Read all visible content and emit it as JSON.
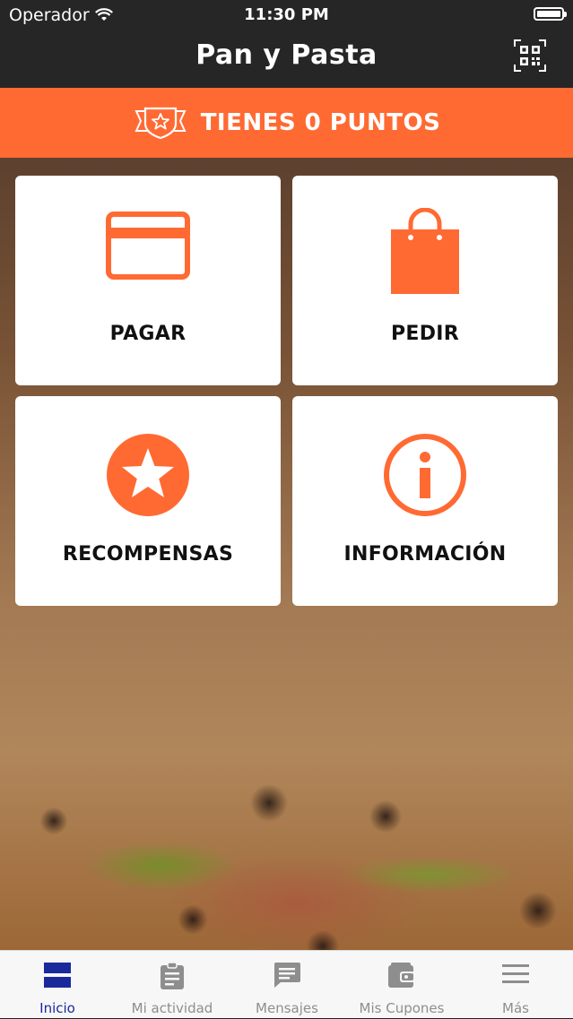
{
  "status": {
    "carrier": "Operador",
    "time": "11:30 PM"
  },
  "header": {
    "title": "Pan y Pasta",
    "qr_icon": "qr-code-icon"
  },
  "points": {
    "text": "TIENES 0 PUNTOS",
    "icon": "badge-star-icon"
  },
  "tiles": [
    {
      "label": "PAGAR",
      "icon": "credit-card-icon"
    },
    {
      "label": "PEDIR",
      "icon": "shopping-bag-icon"
    },
    {
      "label": "RECOMPENSAS",
      "icon": "star-circle-icon"
    },
    {
      "label": "INFORMACIÓN",
      "icon": "info-circle-icon"
    }
  ],
  "tabs": [
    {
      "label": "Inicio",
      "icon": "home-grid-icon",
      "active": true
    },
    {
      "label": "Mi actividad",
      "icon": "clipboard-icon",
      "active": false
    },
    {
      "label": "Mensajes",
      "icon": "message-icon",
      "active": false
    },
    {
      "label": "Mis Cupones",
      "icon": "wallet-icon",
      "active": false
    },
    {
      "label": "Más",
      "icon": "menu-icon",
      "active": false
    }
  ],
  "colors": {
    "accent": "#ff6a33",
    "bar": "#262626",
    "tab_active": "#1a2a9a",
    "tab_inactive": "#8e8e8e"
  }
}
